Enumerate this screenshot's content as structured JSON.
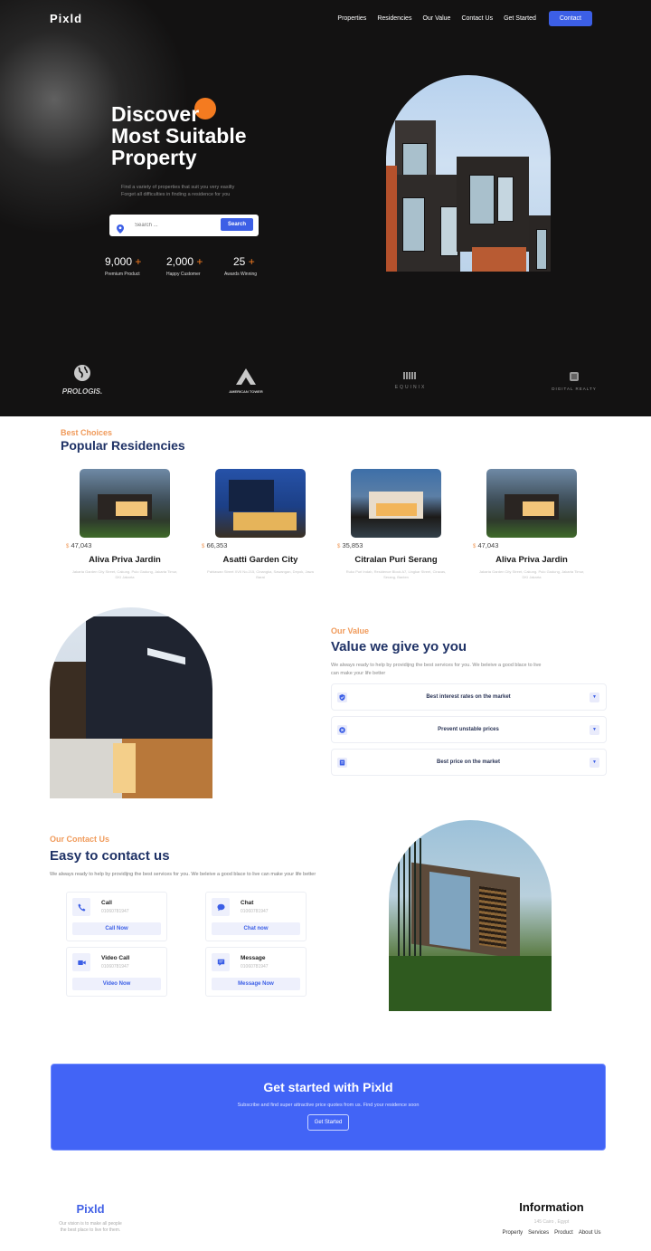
{
  "header": {
    "logo": "Pixld",
    "nav": [
      "Properties",
      "Residencies",
      "Our Value",
      "Contact Us",
      "Get Started"
    ],
    "contact_button": "Contact"
  },
  "hero": {
    "title_line1": "Discover",
    "title_line2": "Most Suitable",
    "title_line3": "Property",
    "subtitle_line1": "Find a variety of properties that suit you very easilty",
    "subtitle_line2": "Forget all difficulties in finding a residence for you",
    "search_placeholder": "Search ...",
    "search_button": "Search",
    "stats": [
      {
        "value": "9,000",
        "suffix": "+",
        "label": "Premium Product"
      },
      {
        "value": "2,000",
        "suffix": "+",
        "label": "Happy Customer"
      },
      {
        "value": "25",
        "suffix": "+",
        "label": "Awards Winning"
      }
    ],
    "image_alt": "modern apartment building"
  },
  "partners": [
    {
      "name": "PROLOGIS.",
      "icon": "globe-icon"
    },
    {
      "name": "AMERICAN TOWER",
      "icon": "tower-a-icon"
    },
    {
      "name": "EQUINIX",
      "icon": "equinix-bars-icon"
    },
    {
      "name": "DIGITAL REALTY",
      "icon": "digital-realty-icon"
    }
  ],
  "residencies": {
    "eyebrow": "Best Choices",
    "title": "Popular Residencies",
    "currency": "$",
    "items": [
      {
        "price": "47,043",
        "name": "Aliva Priva Jardin",
        "address": "Jakarta Garden City Street, Cakung. Pulo Gadung, Jakarta Timur, DKI Jakarta"
      },
      {
        "price": "66,353",
        "name": "Asatti Garden City",
        "address": "Pahlawan Street XVII No.215, Cinangka, Sawangan, Depok, Jawa Barat"
      },
      {
        "price": "35,853",
        "name": "Citralan Puri Serang",
        "address": "Ruko Puri Indah, Residence Block A7, Lingkar Street, Ciracas, Serang, Banten"
      },
      {
        "price": "47,043",
        "name": "Aliva Priva Jardin",
        "address": "Jakarta Garden City Street, Cakung. Pulo Gadung, Jakarta Timur, DKI Jakarta"
      }
    ]
  },
  "value": {
    "eyebrow": "Our Value",
    "title": "Value we give yo you",
    "description": "We always ready to help by providijng the best services for you. We beleive a good blace to live can make your life better",
    "items": [
      {
        "label": "Best interest rates on the market",
        "icon": "shield-check-icon"
      },
      {
        "label": "Prevent unstable prices",
        "icon": "x-circle-icon"
      },
      {
        "label": "Best price on the market",
        "icon": "document-icon"
      }
    ]
  },
  "contact": {
    "eyebrow": "Our Contact Us",
    "title": "Easy to contact us",
    "description": "We always ready to help by providijng the best services for you. We beleive a good blace to live can make your life better",
    "cards": [
      {
        "title": "Call",
        "phone": "01060781947",
        "button": "Call Now",
        "icon": "phone-icon"
      },
      {
        "title": "Chat",
        "phone": "01060781947",
        "button": "Chat now",
        "icon": "chat-bubble-icon"
      },
      {
        "title": "Video Call",
        "phone": "01060781947",
        "button": "Video Now",
        "icon": "video-camera-icon"
      },
      {
        "title": "Message",
        "phone": "01060781947",
        "button": "Message Now",
        "icon": "message-icon"
      }
    ]
  },
  "cta": {
    "title": "Get started with Pixld",
    "subtitle": "Subscribe and find super attractive price quotes from us. Find your residence soon",
    "button": "Get Started"
  },
  "footer": {
    "logo": "Pixld",
    "vision_line1": "Our vision is to make all people",
    "vision_line2": "the best place to live for them.",
    "info_title": "Information",
    "address": "145 Cairo , Egypt",
    "links": [
      "Property",
      "Services",
      "Product",
      "About Us"
    ]
  },
  "colors": {
    "primary": "#3c5fe6",
    "accent": "#f47b20",
    "heading": "#1f3266",
    "hero_bg": "#131212",
    "cta_bg": "#4264f6"
  }
}
